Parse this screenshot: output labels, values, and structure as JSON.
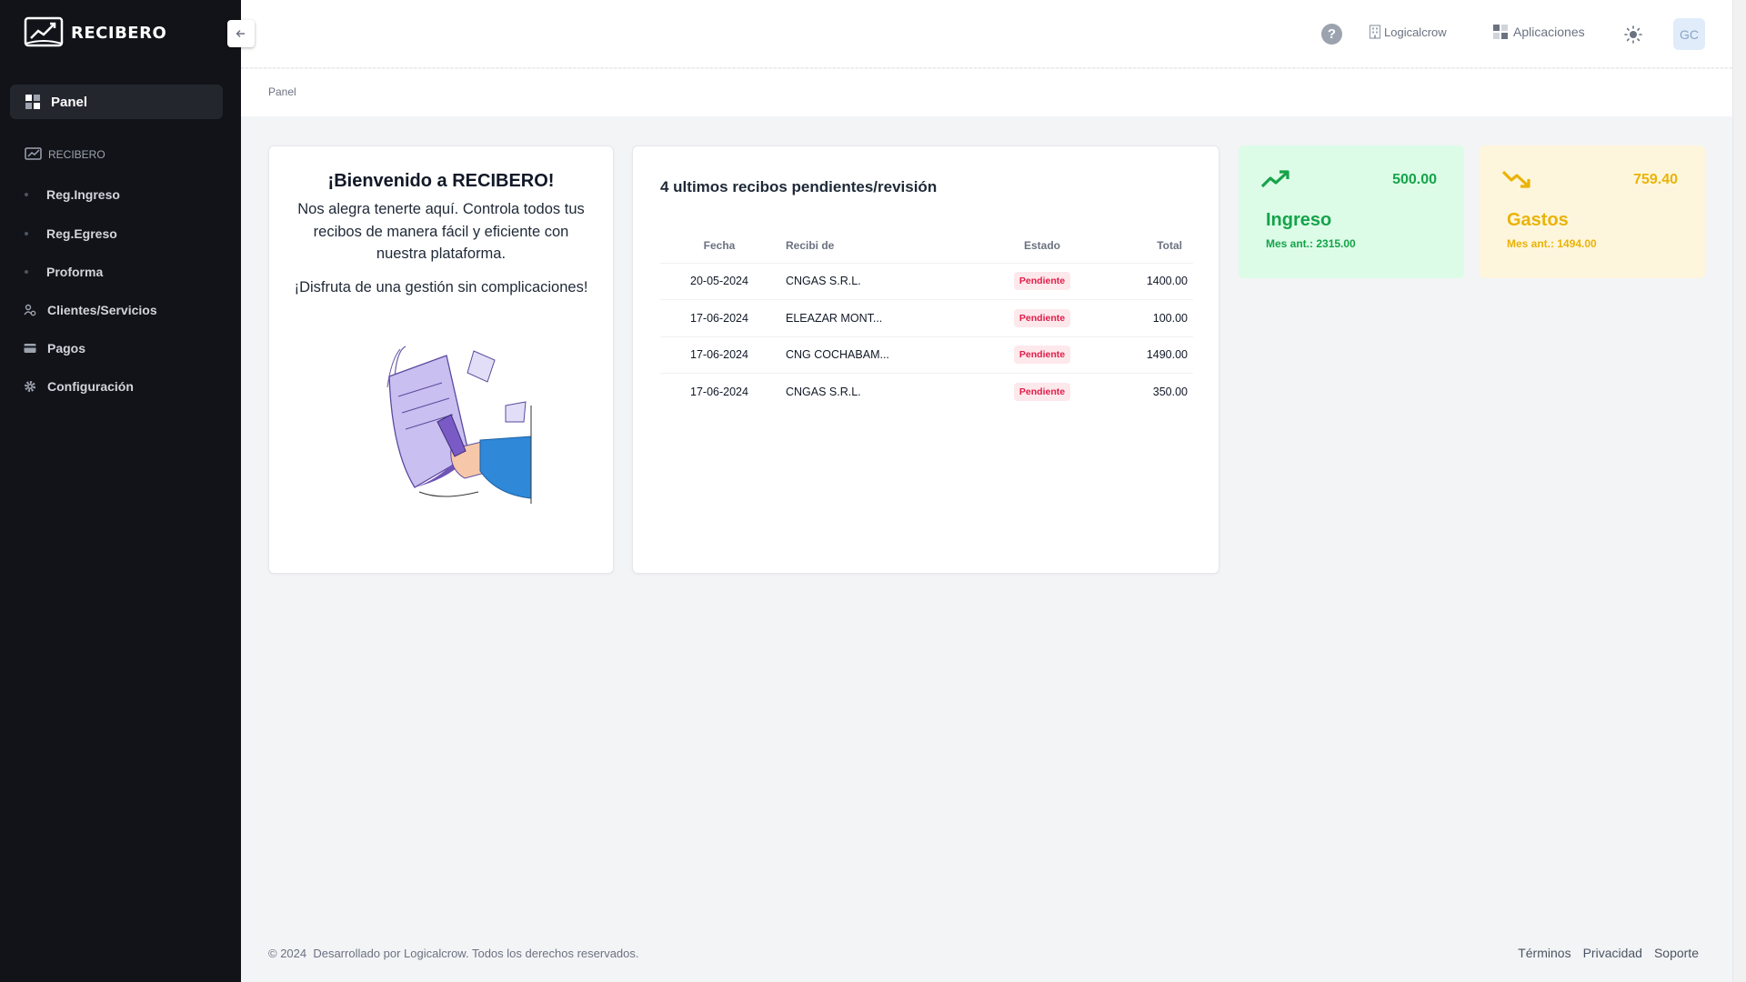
{
  "app": {
    "name": "RECIBERO"
  },
  "sidebar": {
    "active": {
      "label": "Panel"
    },
    "section": "RECIBERO",
    "items": [
      {
        "label": "Reg.Ingreso"
      },
      {
        "label": "Reg.Egreso"
      },
      {
        "label": "Proforma"
      },
      {
        "label": "Clientes/Servicios"
      },
      {
        "label": "Pagos"
      },
      {
        "label": "Configuración"
      }
    ]
  },
  "topbar": {
    "help_icon": "?",
    "org_name": "Logicalcrow",
    "apps_label": "Aplicaciones",
    "avatar_initials": "GC"
  },
  "breadcrumb": "Panel",
  "welcome": {
    "title": "¡Bienvenido a RECIBERO!",
    "message": "Nos alegra tenerte aquí. Controla todos tus recibos de manera fácil y eficiente con nuestra plataforma.",
    "enjoy": "¡Disfruta de una gestión sin complicaciones!"
  },
  "receipts": {
    "title": "4 ultimos recibos pendientes/revisión",
    "columns": [
      "Fecha",
      "Recibi de",
      "Estado",
      "Total"
    ],
    "rows": [
      {
        "fecha": "20-05-2024",
        "recibi": "CNGAS S.R.L.",
        "estado": "Pendiente",
        "total": "1400.00"
      },
      {
        "fecha": "17-06-2024",
        "recibi": "ELEAZAR MONT...",
        "estado": "Pendiente",
        "total": "100.00"
      },
      {
        "fecha": "17-06-2024",
        "recibi": "CNG COCHABAM...",
        "estado": "Pendiente",
        "total": "1490.00"
      },
      {
        "fecha": "17-06-2024",
        "recibi": "CNGAS S.R.L.",
        "estado": "Pendiente",
        "total": "350.00"
      }
    ]
  },
  "stats": {
    "income": {
      "value": "500.00",
      "label": "Ingreso",
      "previous": "Mes ant.: 2315.00",
      "color": "#16a34a",
      "icon": "trending-up-icon"
    },
    "expense": {
      "value": "759.40",
      "label": "Gastos",
      "previous": "Mes ant.: 1494.00",
      "color": "#eab308",
      "icon": "trending-down-icon"
    }
  },
  "footer": {
    "copyright": "© 2024  Desarrollado por Logicalcrow. Todos los derechos reservados.",
    "links": [
      "Términos",
      "Privacidad",
      "Soporte"
    ]
  }
}
